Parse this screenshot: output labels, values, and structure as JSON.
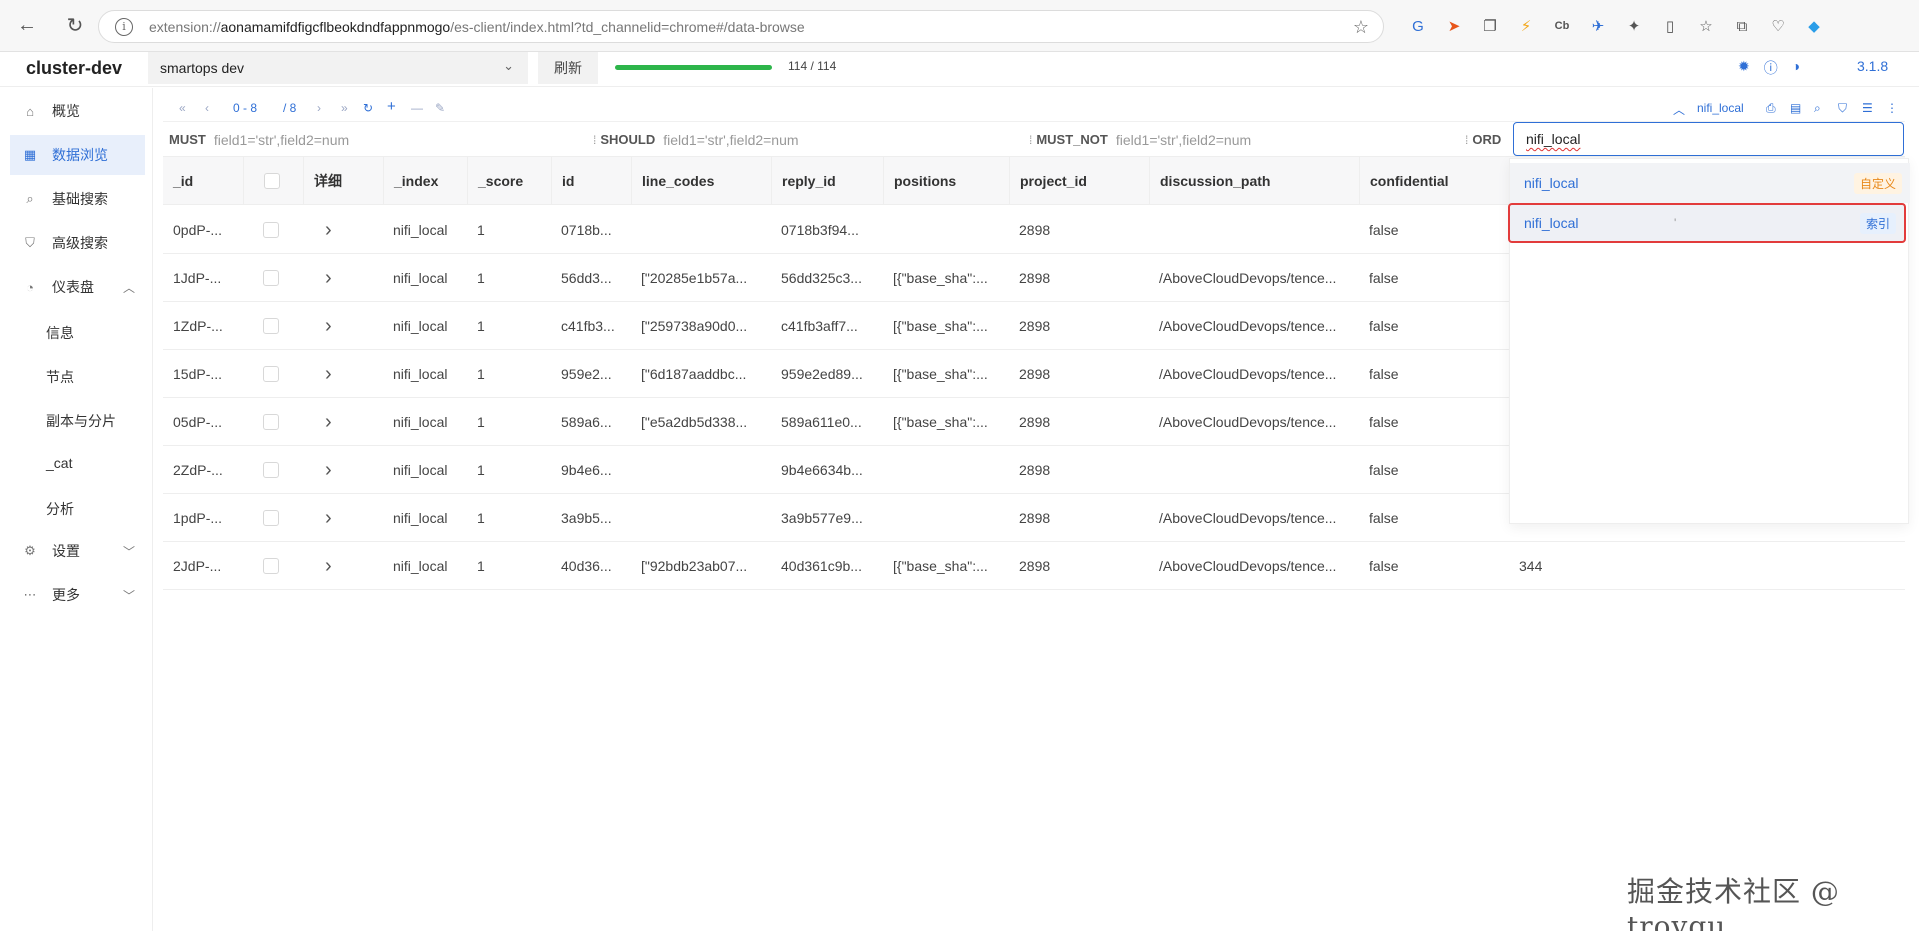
{
  "browser": {
    "url_prefix": "extension://",
    "url_host": "aonamamifdfigcflbeokdndfappnmogo",
    "url_path": "/es-client/index.html?td_channelid=chrome#/data-browse"
  },
  "header": {
    "cluster_name": "cluster-dev",
    "cluster_select": "smartops dev",
    "refresh_label": "刷新",
    "progress": 1.0,
    "progress_text": "114 / 114",
    "version": "3.1.8"
  },
  "sidebar": {
    "items": [
      {
        "label": "概览",
        "icon": "home-icon"
      },
      {
        "label": "数据浏览",
        "icon": "grid-icon"
      },
      {
        "label": "基础搜索",
        "icon": "search-icon"
      },
      {
        "label": "高级搜索",
        "icon": "filter-icon"
      },
      {
        "label": "仪表盘",
        "icon": "dashboard-icon"
      },
      {
        "label": "设置",
        "icon": "gear-icon"
      },
      {
        "label": "更多",
        "icon": "more-icon"
      }
    ],
    "dashboard_subitems": [
      "信息",
      "节点",
      "副本与分片",
      "_cat",
      "分析"
    ]
  },
  "toolbar": {
    "page_range": "0 - 8",
    "page_total": "/ 8",
    "index_name": "nifi_local"
  },
  "filters": {
    "must_label": "MUST",
    "should_label": "SHOULD",
    "must_not_label": "MUST_NOT",
    "order_label": "ORD",
    "placeholder": "field1='str',field2=num"
  },
  "table": {
    "columns": [
      "_id",
      "",
      "详细",
      "_index",
      "_score",
      "id",
      "line_codes",
      "reply_id",
      "positions",
      "project_id",
      "discussion_path",
      "confidential"
    ],
    "rows": [
      [
        "0pdP-...",
        "nifi_local",
        "1",
        "0718b...",
        "",
        "0718b3f94...",
        "",
        "2898",
        "",
        "false",
        ""
      ],
      [
        "1JdP-...",
        "nifi_local",
        "1",
        "56dd3...",
        "[\"20285e1b57a...",
        "56dd325c3...",
        "[{\"base_sha\":...",
        "2898",
        "/AboveCloudDevops/tence...",
        "false",
        ""
      ],
      [
        "1ZdP-...",
        "nifi_local",
        "1",
        "c41fb3...",
        "[\"259738a90d0...",
        "c41fb3aff7...",
        "[{\"base_sha\":...",
        "2898",
        "/AboveCloudDevops/tence...",
        "false",
        ""
      ],
      [
        "15dP-...",
        "nifi_local",
        "1",
        "959e2...",
        "[\"6d187aaddbc...",
        "959e2ed89...",
        "[{\"base_sha\":...",
        "2898",
        "/AboveCloudDevops/tence...",
        "false",
        ""
      ],
      [
        "05dP-...",
        "nifi_local",
        "1",
        "589a6...",
        "[\"e5a2db5d338...",
        "589a611e0...",
        "[{\"base_sha\":...",
        "2898",
        "/AboveCloudDevops/tence...",
        "false",
        ""
      ],
      [
        "2ZdP-...",
        "nifi_local",
        "1",
        "9b4e6...",
        "",
        "9b4e6634b...",
        "",
        "2898",
        "",
        "false",
        ""
      ],
      [
        "1pdP-...",
        "nifi_local",
        "1",
        "3a9b5...",
        "",
        "3a9b577e9...",
        "",
        "2898",
        "/AboveCloudDevops/tence...",
        "false",
        ""
      ],
      [
        "2JdP-...",
        "nifi_local",
        "1",
        "40d36...",
        "[\"92bdb23ab07...",
        "40d361c9b...",
        "[{\"base_sha\":...",
        "2898",
        "/AboveCloudDevops/tence...",
        "false",
        "344"
      ]
    ]
  },
  "dropdown": {
    "input_value": "nifi_local",
    "options": [
      {
        "label": "nifi_local",
        "tag": "自定义"
      },
      {
        "label": "nifi_local",
        "mark": "'",
        "tag": "索引"
      }
    ]
  },
  "watermark": "掘金技术社区 @ troyqu"
}
